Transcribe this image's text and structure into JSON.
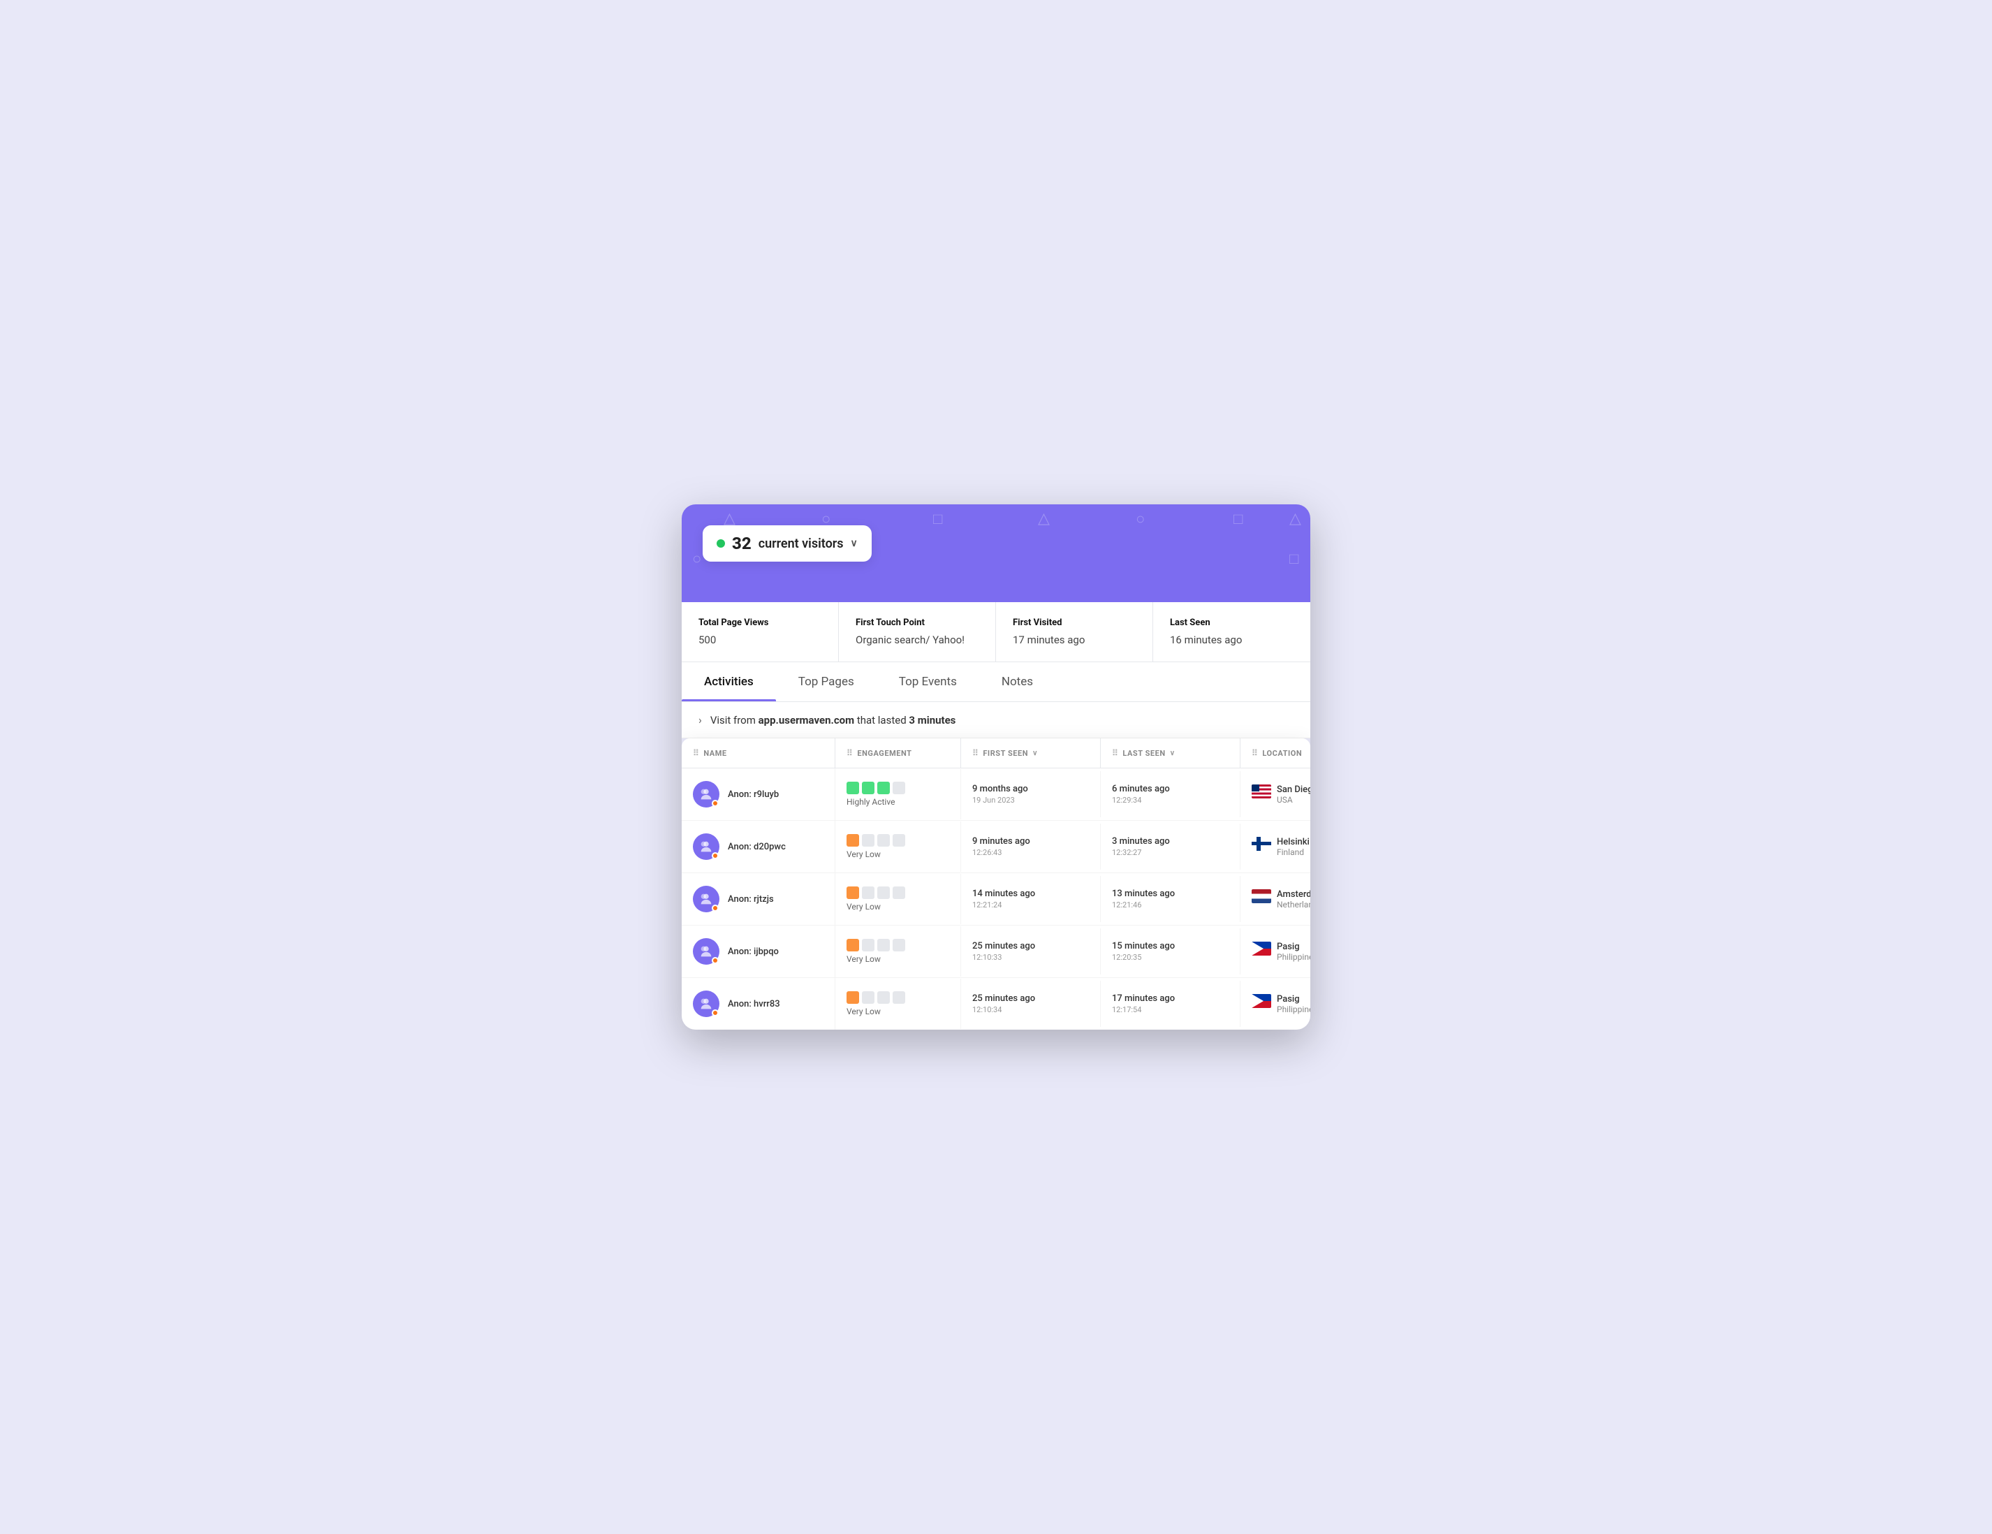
{
  "visitor_badge": {
    "count": "32",
    "label": "current visitors",
    "chevron": "∨"
  },
  "stats": [
    {
      "label": "Total Page Views",
      "value": "500"
    },
    {
      "label": "First Touch Point",
      "value": "Organic search/ Yahoo!"
    },
    {
      "label": "First Visited",
      "value": "17 minutes ago"
    },
    {
      "label": "Last Seen",
      "value": "16 minutes ago"
    }
  ],
  "tabs": [
    {
      "label": "Activities",
      "active": true
    },
    {
      "label": "Top Pages",
      "active": false
    },
    {
      "label": "Top Events",
      "active": false
    },
    {
      "label": "Notes",
      "active": false
    }
  ],
  "activity": {
    "text_prefix": "Visit from",
    "domain": "app.usermaven.com",
    "text_middle": "that lasted",
    "duration": "3 minutes"
  },
  "table": {
    "columns": [
      {
        "icon": "⠿",
        "label": "NAME"
      },
      {
        "icon": "⠿",
        "label": "ENGAGEMENT"
      },
      {
        "icon": "⠿",
        "label": "FIRST SEEN",
        "sort": true
      },
      {
        "icon": "⠿",
        "label": "LAST SEEN",
        "sort": true
      },
      {
        "icon": "⠿",
        "label": "LOCATION"
      }
    ],
    "rows": [
      {
        "name": "Anon: r9luyb",
        "engagement_level": "highly_active",
        "engagement_label": "Highly Active",
        "first_seen_rel": "9 months ago",
        "first_seen_date": "19 Jun 2023",
        "last_seen_rel": "6 minutes ago",
        "last_seen_time": "12:29:34",
        "city": "San Diego",
        "country": "USA",
        "flag_type": "usa"
      },
      {
        "name": "Anon: d20pwc",
        "engagement_level": "very_low",
        "engagement_label": "Very Low",
        "first_seen_rel": "9 minutes ago",
        "first_seen_date": "12:26:43",
        "last_seen_rel": "3 minutes ago",
        "last_seen_time": "12:32:27",
        "city": "Helsinki",
        "country": "Finland",
        "flag_type": "finland"
      },
      {
        "name": "Anon: rjtzjs",
        "engagement_level": "very_low",
        "engagement_label": "Very Low",
        "first_seen_rel": "14 minutes ago",
        "first_seen_date": "12:21:24",
        "last_seen_rel": "13 minutes ago",
        "last_seen_time": "12:21:46",
        "city": "Amsterdam",
        "country": "Netherlands",
        "flag_type": "netherlands"
      },
      {
        "name": "Anon: ijbpqo",
        "engagement_level": "very_low",
        "engagement_label": "Very Low",
        "first_seen_rel": "25 minutes ago",
        "first_seen_date": "12:10:33",
        "last_seen_rel": "15 minutes ago",
        "last_seen_time": "12:20:35",
        "city": "Pasig",
        "country": "Philippines",
        "flag_type": "philippines"
      },
      {
        "name": "Anon: hvrr83",
        "engagement_level": "very_low",
        "engagement_label": "Very Low",
        "first_seen_rel": "25 minutes ago",
        "first_seen_date": "12:10:34",
        "last_seen_rel": "17 minutes ago",
        "last_seen_time": "12:17:54",
        "city": "Pasig",
        "country": "Philippines",
        "flag_type": "philippines"
      }
    ]
  },
  "bg_shapes": [
    "△",
    "○",
    "□",
    "△",
    "○",
    "□",
    "△",
    "○",
    "□",
    "△",
    "○",
    "□",
    "△",
    "○",
    "□",
    "△",
    "○",
    "□"
  ]
}
